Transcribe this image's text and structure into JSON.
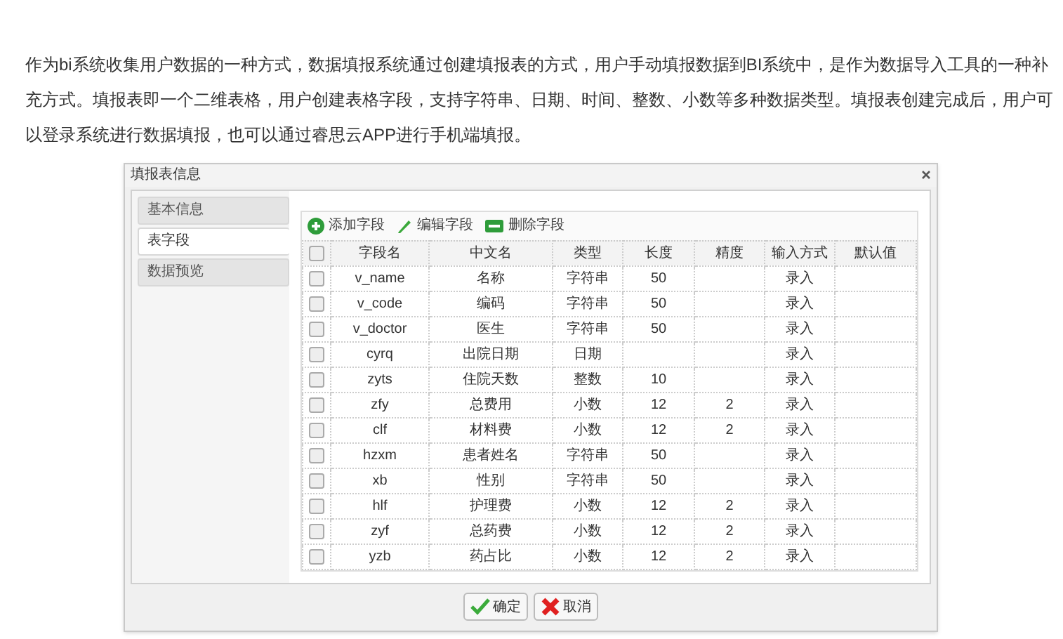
{
  "intro": "作为bi系统收集用户数据的一种方式，数据填报系统通过创建填报表的方式，用户手动填报数据到BI系统中，是作为数据导入工具的一种补充方式。填报表即一个二维表格，用户创建表格字段，支持字符串、日期、时间、整数、小数等多种数据类型。填报表创建完成后，用户可以登录系统进行数据填报，也可以通过睿思云APP进行手机端填报。",
  "dialog": {
    "title": "填报表信息",
    "tabs": [
      {
        "label": "基本信息",
        "selected": false
      },
      {
        "label": "表字段",
        "selected": true
      },
      {
        "label": "数据预览",
        "selected": false
      }
    ],
    "toolbar": [
      {
        "kind": "add",
        "label": "添加字段"
      },
      {
        "kind": "edit",
        "label": "编辑字段"
      },
      {
        "kind": "delete",
        "label": "删除字段"
      }
    ],
    "table": {
      "all_checked": false,
      "columns": [
        "字段名",
        "中文名",
        "类型",
        "长度",
        "精度",
        "输入方式",
        "默认值"
      ],
      "rows": [
        {
          "checked": false,
          "cells": [
            "v_name",
            "名称",
            "字符串",
            "50",
            "",
            "录入",
            ""
          ]
        },
        {
          "checked": false,
          "cells": [
            "v_code",
            "编码",
            "字符串",
            "50",
            "",
            "录入",
            ""
          ]
        },
        {
          "checked": false,
          "cells": [
            "v_doctor",
            "医生",
            "字符串",
            "50",
            "",
            "录入",
            ""
          ]
        },
        {
          "checked": false,
          "cells": [
            "cyrq",
            "出院日期",
            "日期",
            "",
            "",
            "录入",
            ""
          ]
        },
        {
          "checked": false,
          "cells": [
            "zyts",
            "住院天数",
            "整数",
            "10",
            "",
            "录入",
            ""
          ]
        },
        {
          "checked": false,
          "cells": [
            "zfy",
            "总费用",
            "小数",
            "12",
            "2",
            "录入",
            ""
          ]
        },
        {
          "checked": false,
          "cells": [
            "clf",
            "材料费",
            "小数",
            "12",
            "2",
            "录入",
            ""
          ]
        },
        {
          "checked": false,
          "cells": [
            "hzxm",
            "患者姓名",
            "字符串",
            "50",
            "",
            "录入",
            ""
          ]
        },
        {
          "checked": false,
          "cells": [
            "xb",
            "性别",
            "字符串",
            "50",
            "",
            "录入",
            ""
          ]
        },
        {
          "checked": false,
          "cells": [
            "hlf",
            "护理费",
            "小数",
            "12",
            "2",
            "录入",
            ""
          ]
        },
        {
          "checked": false,
          "cells": [
            "zyf",
            "总药费",
            "小数",
            "12",
            "2",
            "录入",
            ""
          ]
        },
        {
          "checked": false,
          "cells": [
            "yzb",
            "药占比",
            "小数",
            "12",
            "2",
            "录入",
            ""
          ]
        }
      ]
    },
    "buttons": [
      {
        "kind": "ok",
        "label": "确定"
      },
      {
        "kind": "cancel",
        "label": "取消"
      }
    ]
  }
}
